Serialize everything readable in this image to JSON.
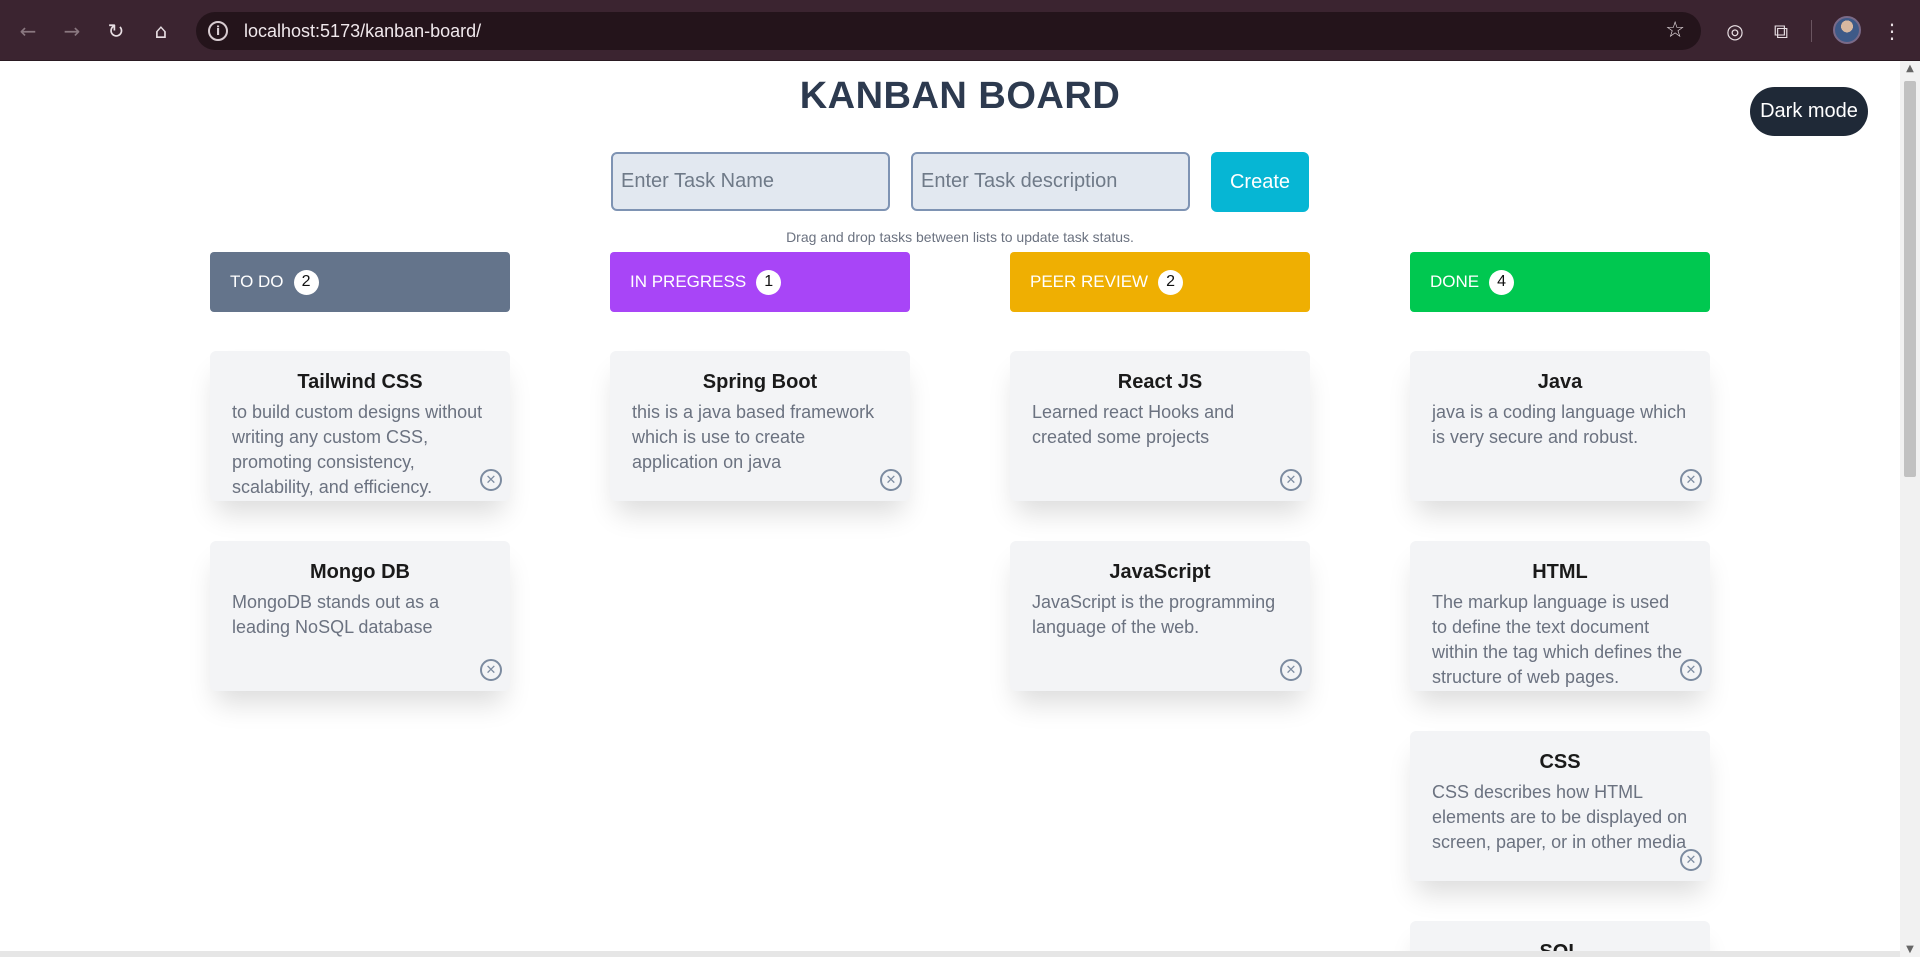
{
  "browser": {
    "url": "localhost:5173/kanban-board/"
  },
  "page": {
    "title": "KANBAN BOARD",
    "dark_mode_label": "Dark mode",
    "task_name_placeholder": "Enter Task Name",
    "task_desc_placeholder": "Enter Task description",
    "create_label": "Create",
    "hint": "Drag and drop tasks between lists to update task status."
  },
  "columns": [
    {
      "label": "TO DO",
      "count": "2",
      "color": "#64748b",
      "cards": [
        {
          "title": "Tailwind CSS",
          "desc": "to build custom designs without writing any custom CSS, promoting consistency, scalability, and efficiency."
        },
        {
          "title": "Mongo DB",
          "desc": "MongoDB stands out as a leading NoSQL database"
        }
      ]
    },
    {
      "label": "IN PREGRESS",
      "count": "1",
      "color": "#a845f7",
      "cards": [
        {
          "title": "Spring Boot",
          "desc": "this is a java based framework which is use to create application on java"
        }
      ]
    },
    {
      "label": "PEER REVIEW",
      "count": "2",
      "color": "#efaf02",
      "cards": [
        {
          "title": "React JS",
          "desc": "Learned react Hooks and created some projects"
        },
        {
          "title": "JavaScript",
          "desc": "JavaScript is the programming language of the web."
        }
      ]
    },
    {
      "label": "DONE",
      "count": "4",
      "color": "#00c850",
      "cards": [
        {
          "title": "Java",
          "desc": "java is a coding language which is very secure and robust."
        },
        {
          "title": "HTML",
          "desc": "The markup language is used to define the text document within the tag which defines the structure of web pages."
        },
        {
          "title": "CSS",
          "desc": "CSS describes how HTML elements are to be displayed on screen, paper, or in other media"
        },
        {
          "title": "SQL",
          "desc": ""
        }
      ]
    }
  ]
}
